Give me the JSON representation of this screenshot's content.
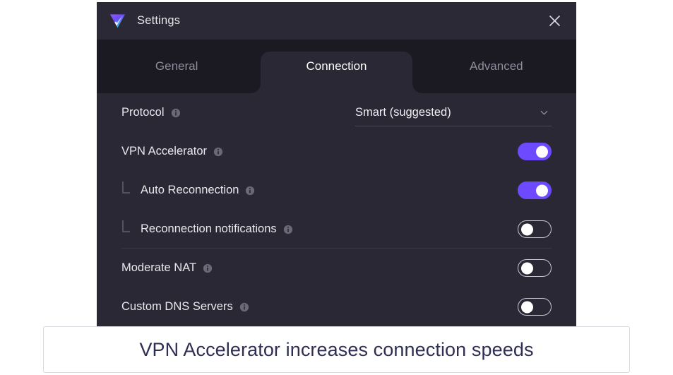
{
  "window": {
    "title": "Settings",
    "logo_icon": "protonvpn-logo-icon",
    "close_icon": "close-icon"
  },
  "tabs": [
    {
      "label": "General",
      "active": false
    },
    {
      "label": "Connection",
      "active": true
    },
    {
      "label": "Advanced",
      "active": false
    }
  ],
  "settings": [
    {
      "label": "Protocol",
      "info_icon": "info-icon",
      "control": "dropdown",
      "value": "Smart (suggested)",
      "chevron_icon": "chevron-down-icon",
      "indented": false
    },
    {
      "label": "VPN Accelerator",
      "info_icon": "info-icon",
      "control": "toggle",
      "state": "on",
      "indented": false
    },
    {
      "label": "Auto Reconnection",
      "info_icon": "info-icon",
      "control": "toggle",
      "state": "on",
      "indented": true
    },
    {
      "label": "Reconnection notifications",
      "info_icon": "info-icon",
      "control": "toggle",
      "state": "off",
      "indented": true
    },
    {
      "label": "Moderate NAT",
      "info_icon": "info-icon",
      "control": "toggle",
      "state": "off",
      "indented": false
    },
    {
      "label": "Custom DNS Servers",
      "info_icon": "info-icon",
      "control": "toggle",
      "state": "off",
      "indented": false
    }
  ],
  "caption": {
    "text": "VPN Accelerator increases connection speeds"
  },
  "colors": {
    "toggle_on": "#6d4aff",
    "window_bg": "#2a2834",
    "tabstrip_bg": "#1b1a23",
    "caption_text": "#2f2f55"
  }
}
